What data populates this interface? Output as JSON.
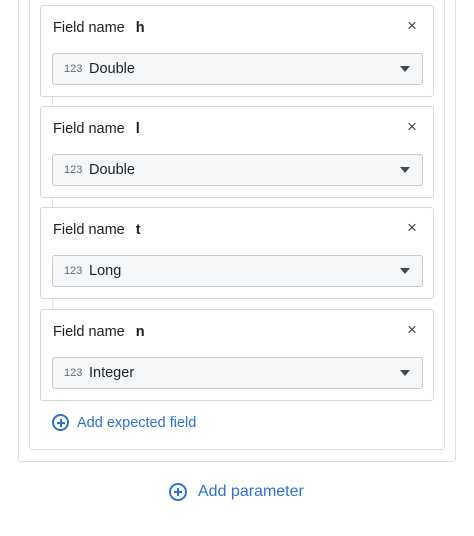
{
  "fields": [
    {
      "label": "Field name",
      "name": "h",
      "type_icon": "123",
      "type": "Double"
    },
    {
      "label": "Field name",
      "name": "l",
      "type_icon": "123",
      "type": "Double"
    },
    {
      "label": "Field name",
      "name": "t",
      "type_icon": "123",
      "type": "Long"
    },
    {
      "label": "Field name",
      "name": "n",
      "type_icon": "123",
      "type": "Integer"
    }
  ],
  "remove_icon": "×",
  "add_expected_field": "Add expected field",
  "add_parameter": "Add parameter",
  "colors": {
    "accent": "#2d72d2",
    "border": "#d3d8de",
    "select_bg": "#f6f7f9"
  }
}
